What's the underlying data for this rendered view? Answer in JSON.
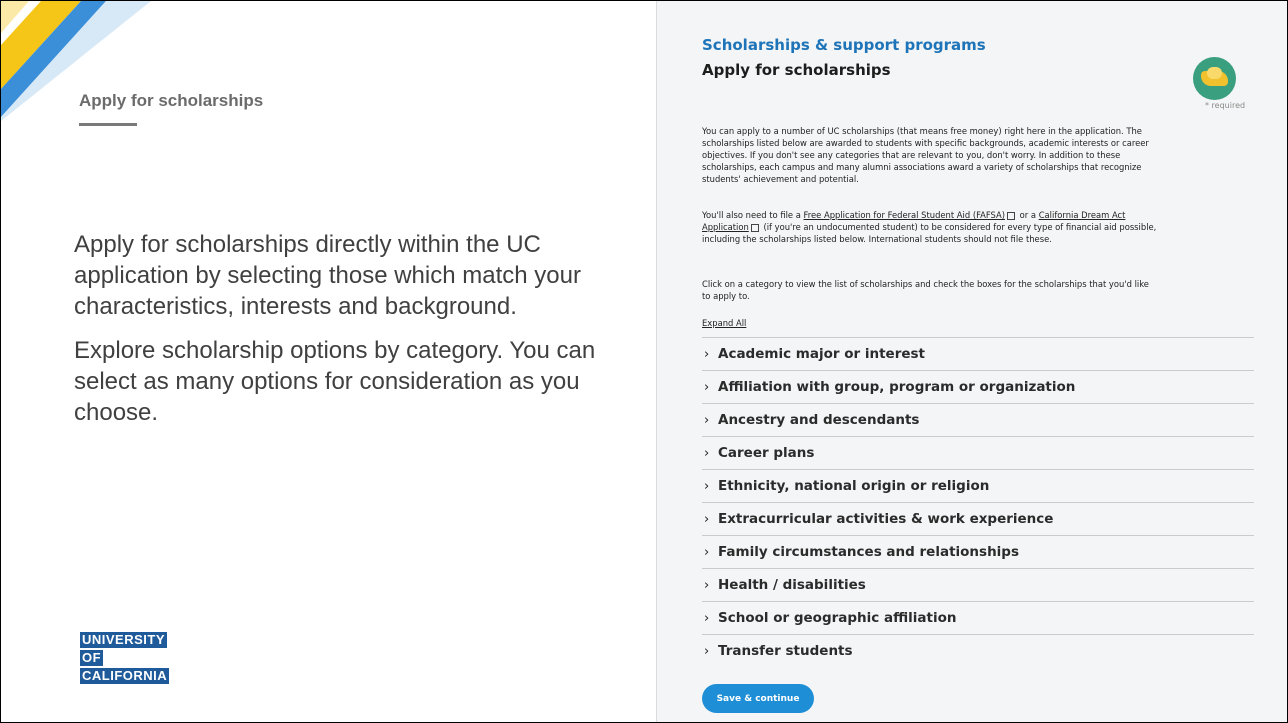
{
  "slide": {
    "title": "Apply for scholarships",
    "body": [
      "Apply for scholarships directly within the UC application by selecting those which match your characteristics, interests and background.",
      "Explore scholarship options by category. You can select as many options for consideration as you choose."
    ],
    "logo_lines": [
      "UNIVERSITY",
      "OF",
      "CALIFORNIA"
    ]
  },
  "form": {
    "section_label": "Scholarships & support programs",
    "heading": "Apply for scholarships",
    "required_note": "* required",
    "badge_icon": "handshake-icon",
    "paragraph1": "You can apply to a number of UC scholarships (that means free money) right here in the application. The scholarships listed below are awarded to students with specific backgrounds, academic interests or career objectives. If you don't see any categories that are relevant to you, don't worry. In addition to these scholarships, each campus and many alumni associations award a variety of scholarships that recognize students' achievement and potential.",
    "paragraph2": {
      "prefix": "You'll also need to file a ",
      "link1": "Free Application for Federal Student Aid (FAFSA)",
      "middle": " or a ",
      "link2": "California Dream Act Application",
      "suffix": " (if you're an undocumented student) to be considered for every type of financial aid possible, including the scholarships listed below. International students should not file these."
    },
    "paragraph3": "Click on a category to view the list of scholarships and check the boxes for the scholarships that you'd like to apply to.",
    "expand_all": "Expand All",
    "categories": [
      "Academic major or interest",
      "Affiliation with group, program or organization",
      "Ancestry and descendants",
      "Career plans",
      "Ethnicity, national origin or religion",
      "Extracurricular activities & work experience",
      "Family circumstances and relationships",
      "Health / disabilities",
      "School or geographic affiliation",
      "Transfer students"
    ],
    "save_label": "Save & continue"
  },
  "colors": {
    "accent": "#1e74b8",
    "button": "#1e8fd6",
    "stripe_yellow": "#f5c518",
    "stripe_blue": "#3b8fd9"
  }
}
